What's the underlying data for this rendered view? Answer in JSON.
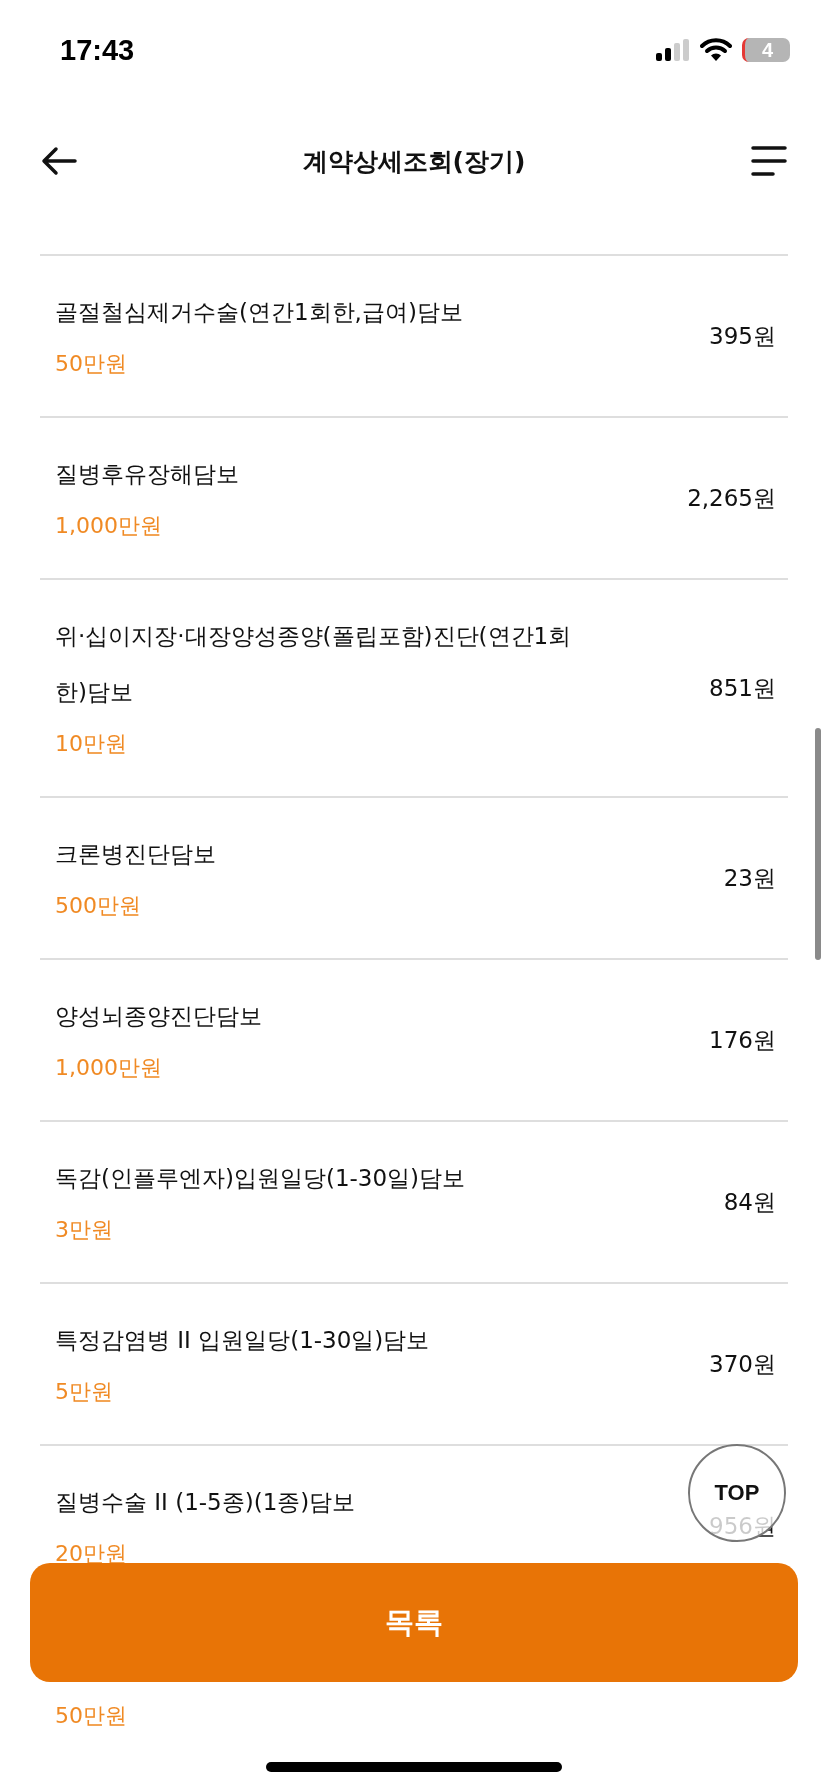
{
  "status_bar": {
    "time": "17:43",
    "battery": "4"
  },
  "header": {
    "title": "계약상세조회(장기)"
  },
  "coverages": [
    {
      "name": "골절철심제거수술(연간1회한,급여)담보",
      "amount": "50만원",
      "premium": "395원"
    },
    {
      "name": "질병후유장해담보",
      "amount": "1,000만원",
      "premium": "2,265원"
    },
    {
      "name": "위·십이지장·대장양성종양(폴립포함)진단(연간1회한)담보",
      "amount": "10만원",
      "premium": "851원"
    },
    {
      "name": "크론병진단담보",
      "amount": "500만원",
      "premium": "23원"
    },
    {
      "name": "양성뇌종양진단담보",
      "amount": "1,000만원",
      "premium": "176원"
    },
    {
      "name": "독감(인플루엔자)입원일당(1-30일)담보",
      "amount": "3만원",
      "premium": "84원"
    },
    {
      "name": "특정감염병 II 입원일당(1-30일)담보",
      "amount": "5만원",
      "premium": "370원"
    },
    {
      "name": "질병수술 II (1-5종)(1종)담보",
      "amount": "20만원",
      "premium": "956원"
    },
    {
      "amount": "50만원"
    }
  ],
  "top_button": {
    "label": "TOP"
  },
  "list_button": {
    "label": "목록"
  }
}
